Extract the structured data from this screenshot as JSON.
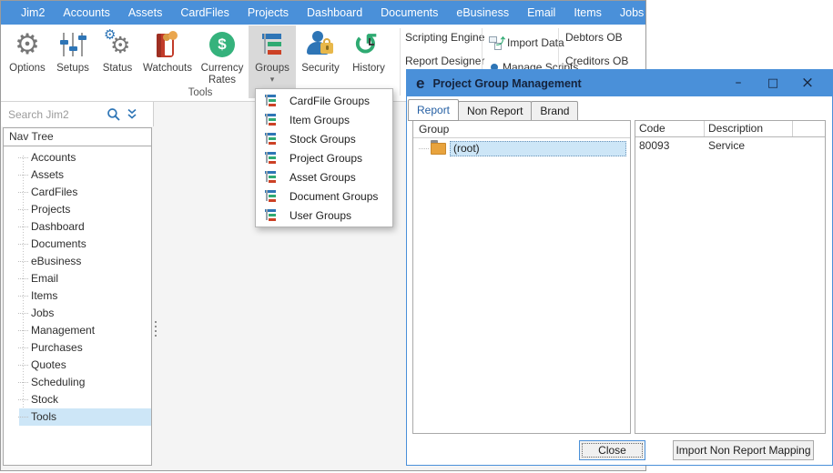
{
  "colors": {
    "accent_blue": "#4a90d9",
    "selection_blue": "#cde6f7",
    "tab_active_text": "#2660a4",
    "pressed_gray": "#d9d9d9",
    "icon_green": "#35b27c",
    "icon_red": "#c13b2a",
    "icon_gold": "#e8b84b",
    "icon_blue": "#2e75b6"
  },
  "icons": {
    "options": "gear-icon",
    "setups": "sliders-icon",
    "status": "double-gear-icon",
    "watchouts": "book-icon",
    "currency": "dollar-coin-icon",
    "groups": "tree-icon",
    "security": "person-lock-icon",
    "history": "clock-undo-icon",
    "search": "magnifier-icon",
    "expand": "double-chevron-down-icon",
    "folder": "folder-icon",
    "import": "import-pages-icon"
  },
  "menubar": {
    "items": [
      "Jim2",
      "Accounts",
      "Assets",
      "CardFiles",
      "Projects",
      "Dashboard",
      "Documents",
      "eBusiness",
      "Email",
      "Items",
      "Jobs"
    ]
  },
  "ribbon": {
    "group_caption": "Tools",
    "buttons": [
      {
        "label": "Options"
      },
      {
        "label": "Setups"
      },
      {
        "label": "Status"
      },
      {
        "label": "Watchouts"
      },
      {
        "label": "Currency Rates"
      },
      {
        "label": "Groups"
      },
      {
        "label": "Security"
      },
      {
        "label": "History"
      }
    ],
    "links": {
      "scripting_engine": "Scripting Engine",
      "report_designer": "Report Designer",
      "import_data": "Import Data",
      "manage_scripts": "Manage Scripts",
      "debtors_ob": "Debtors OB",
      "creditors_ob": "Creditors OB"
    }
  },
  "sidebar": {
    "search_placeholder": "Search Jim2",
    "nav": {
      "header": "Nav Tree",
      "items": [
        "Accounts",
        "Assets",
        "CardFiles",
        "Projects",
        "Dashboard",
        "Documents",
        "eBusiness",
        "Email",
        "Items",
        "Jobs",
        "Management",
        "Purchases",
        "Quotes",
        "Scheduling",
        "Stock",
        "Tools"
      ],
      "selected_item": "Tools"
    }
  },
  "groups_menu": {
    "items": [
      "CardFile Groups",
      "Item Groups",
      "Stock Groups",
      "Project Groups",
      "Asset Groups",
      "Document Groups",
      "User Groups"
    ]
  },
  "dialog": {
    "title": "Project Group Management",
    "window_controls": {
      "minimize": "–",
      "maximize": "□",
      "close": "×"
    },
    "tabs": [
      "Report",
      "Non Report",
      "Brand"
    ],
    "active_tab": "Report",
    "group_panel": {
      "header": "Group",
      "root_item": "(root)"
    },
    "table": {
      "columns": [
        "Code",
        "Description"
      ],
      "rows": [
        [
          "80093",
          "Service"
        ]
      ]
    },
    "buttons": {
      "close": "Close",
      "import": "Import Non Report Mapping"
    }
  }
}
